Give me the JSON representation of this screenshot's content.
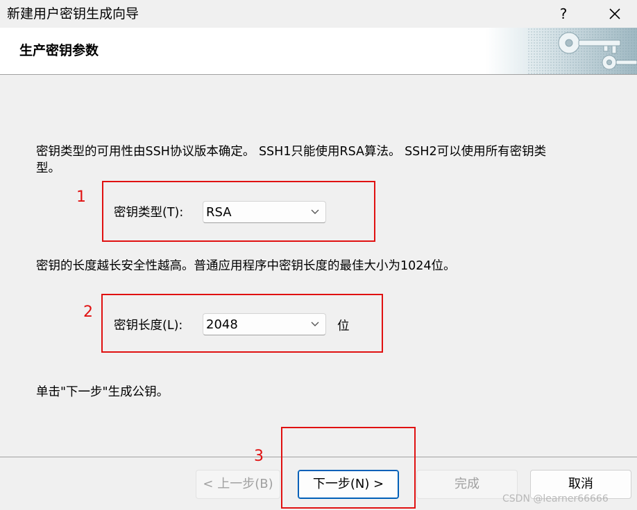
{
  "window": {
    "title": "新建用户密钥生成向导",
    "help_label": "?"
  },
  "header": {
    "title": "生产密钥参数"
  },
  "content": {
    "intro_line1": "密钥类型的可用性由SSH协议版本确定。 SSH1只能使用RSA算法。 SSH2可以使用所有密钥类",
    "intro_line2": "型。",
    "key_type_label": "密钥类型(T):",
    "key_type_value": "RSA",
    "length_text": "密钥的长度越长安全性越高。普通应用程序中密钥长度的最佳大小为1024位。",
    "key_length_label": "密钥长度(L):",
    "key_length_value": "2048",
    "key_length_unit": "位",
    "hint_text": "单击\"下一步\"生成公钥。"
  },
  "annotations": {
    "num1": "1",
    "num2": "2",
    "num3": "3",
    "color": "#e01010"
  },
  "buttons": {
    "back": "< 上一步(B)",
    "next": "下一步(N) >",
    "finish": "完成",
    "cancel": "取消"
  },
  "watermark": "CSDN @learner66666"
}
